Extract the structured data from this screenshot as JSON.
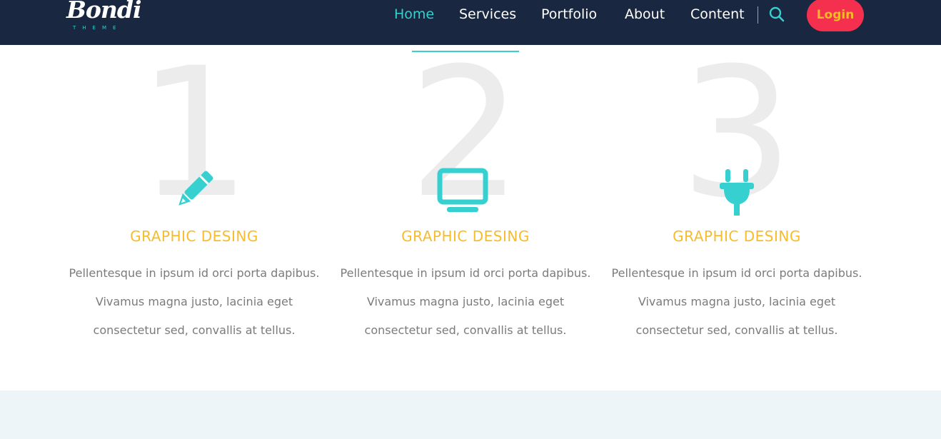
{
  "brand": {
    "name": "Bondi",
    "tagline": "THEME"
  },
  "nav": {
    "items": [
      {
        "label": "Home",
        "active": true
      },
      {
        "label": "Services",
        "active": false
      },
      {
        "label": "Portfolio",
        "active": false
      },
      {
        "label": "About",
        "active": false
      },
      {
        "label": "Content",
        "active": false
      }
    ],
    "search_icon": "search-icon",
    "login_label": "Login"
  },
  "features": [
    {
      "number": "1",
      "icon": "pencil-icon",
      "title": "GRAPHIC DESING",
      "text": "Pellentesque in ipsum id orci porta dapibus. Vivamus magna justo, lacinia eget consectetur sed, convallis at tellus."
    },
    {
      "number": "2",
      "icon": "monitor-icon",
      "title": "GRAPHIC DESING",
      "text": "Pellentesque in ipsum id orci porta dapibus. Vivamus magna justo, lacinia eget consectetur sed, convallis at tellus."
    },
    {
      "number": "3",
      "icon": "plug-icon",
      "title": "GRAPHIC DESING",
      "text": "Pellentesque in ipsum id orci porta dapibus. Vivamus magna justo, lacinia eget consectetur sed, convallis at tellus."
    }
  ],
  "colors": {
    "navbar_bg": "#1a2740",
    "accent": "#35d0cf",
    "title": "#f6bc2c",
    "login_bg": "#f5304f",
    "login_text": "#f6b829",
    "number": "#ececec",
    "body_text": "#7b7b7b",
    "bottom_band": "#edf5f9"
  }
}
